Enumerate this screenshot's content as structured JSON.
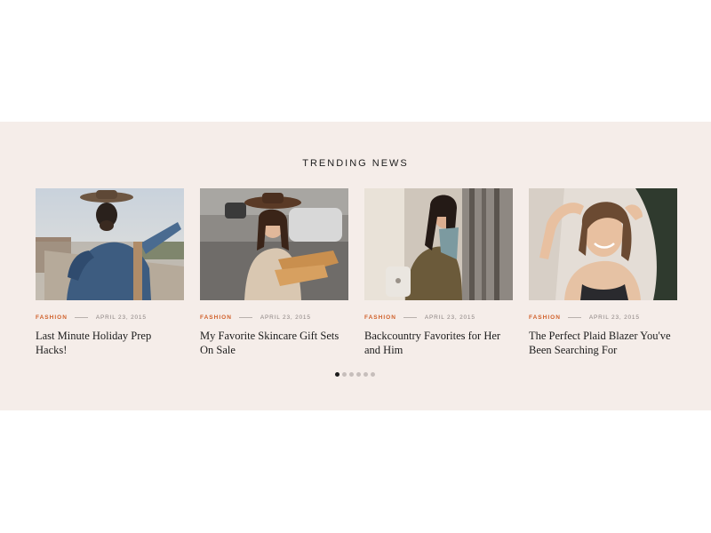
{
  "section": {
    "title": "TRENDING NEWS"
  },
  "articles": [
    {
      "category": "FASHION",
      "date": "APRIL 23, 2015",
      "title": "Last Minute Holiday Prep Hacks!"
    },
    {
      "category": "FASHION",
      "date": "APRIL 23, 2015",
      "title": "My Favorite Skincare Gift Sets On Sale"
    },
    {
      "category": "FASHION",
      "date": "APRIL 23, 2015",
      "title": "Backcountry Favorites for Her and Him"
    },
    {
      "category": "FASHION",
      "date": "APRIL 23, 2015",
      "title": "The Perfect Plaid Blazer You've Been Searching For"
    }
  ],
  "carousel": {
    "pages": 6,
    "active_index": 0
  },
  "colors": {
    "section_background": "#f5ede9",
    "category_accent": "#d0602a",
    "dot_active": "#1c1c1c",
    "dot_inactive": "#c6bebb"
  }
}
